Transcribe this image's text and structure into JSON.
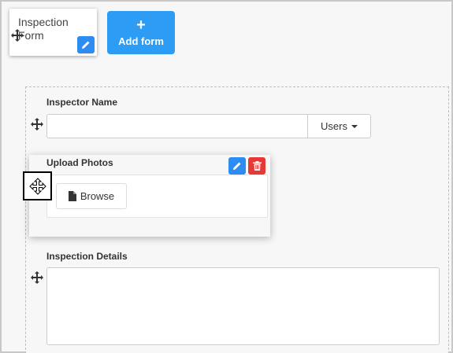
{
  "form_card": {
    "title": "Inspection Form",
    "edit_icon": "pencil-icon",
    "move_icon": "move-icon"
  },
  "add_form": {
    "icon": "plus-icon",
    "plus_glyph": "+",
    "label": "Add form"
  },
  "fields": {
    "inspector_name": {
      "label": "Inspector Name",
      "value": "",
      "dropdown_label": "Users"
    },
    "upload_photos": {
      "label": "Upload Photos",
      "browse_label": "Browse",
      "edit_icon": "pencil-icon",
      "delete_icon": "trash-icon"
    },
    "inspection_details": {
      "label": "Inspection Details",
      "value": ""
    }
  },
  "colors": {
    "primary": "#2d9cf5",
    "edit": "#2d8cf0",
    "danger": "#e53935",
    "background": "#f7f7f7",
    "border": "#cccccc"
  }
}
